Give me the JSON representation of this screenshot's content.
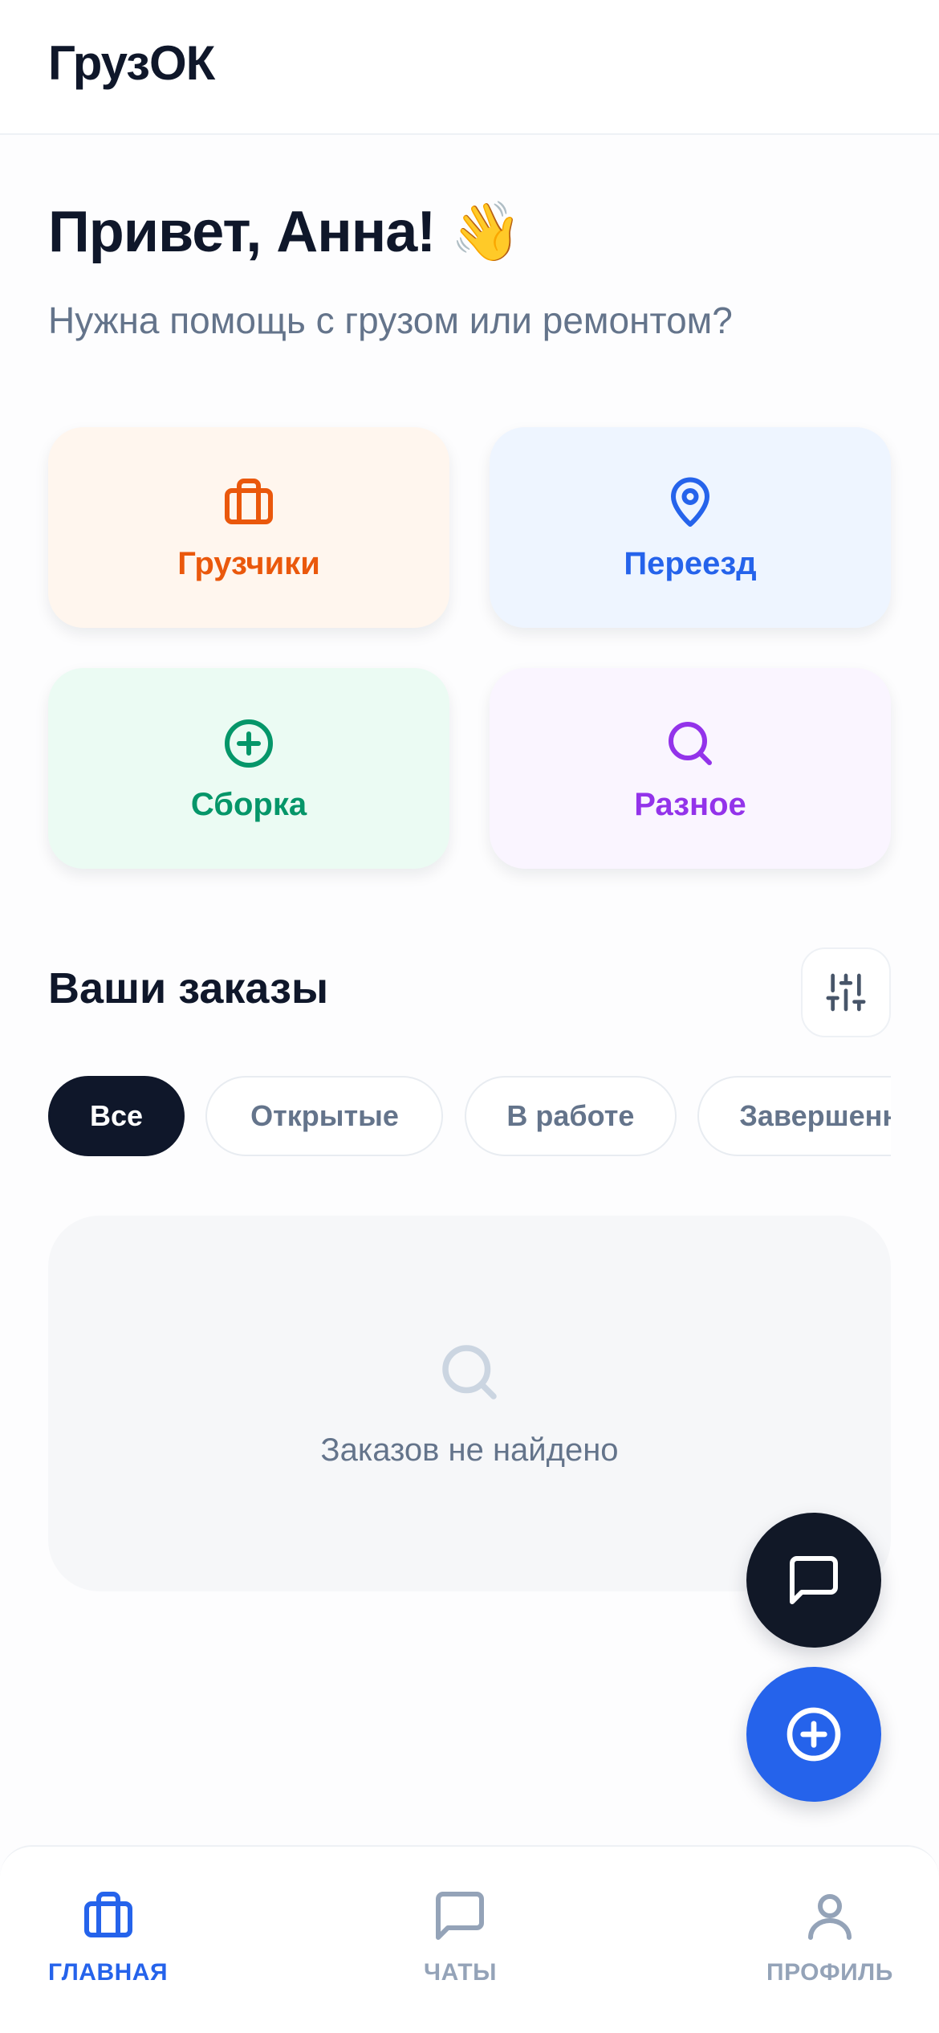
{
  "header": {
    "app_title": "ГрузОК"
  },
  "greeting": {
    "title": "Привет, Анна! 👋",
    "subtitle": "Нужна помощь с грузом или ремонтом?"
  },
  "categories": [
    {
      "label": "Грузчики",
      "icon": "briefcase-icon",
      "color": "#ea580c"
    },
    {
      "label": "Переезд",
      "icon": "map-pin-icon",
      "color": "#2563eb"
    },
    {
      "label": "Сборка",
      "icon": "plus-circle-icon",
      "color": "#059669"
    },
    {
      "label": "Разное",
      "icon": "search-icon",
      "color": "#9333ea"
    }
  ],
  "orders": {
    "title": "Ваши заказы",
    "filter_icon": "sliders-icon",
    "chips": [
      {
        "label": "Все",
        "active": true
      },
      {
        "label": "Открытые",
        "active": false
      },
      {
        "label": "В работе",
        "active": false
      },
      {
        "label": "Завершенные",
        "active": false
      }
    ],
    "empty_text": "Заказов не найдено"
  },
  "fabs": {
    "chat_icon": "chat-icon",
    "add_icon": "plus-circle-icon"
  },
  "tabbar": {
    "items": [
      {
        "label": "ГЛАВНАЯ",
        "icon": "briefcase-icon",
        "active": true
      },
      {
        "label": "ЧАТЫ",
        "icon": "chat-icon",
        "active": false
      },
      {
        "label": "ПРОФИЛЬ",
        "icon": "user-icon",
        "active": false
      }
    ]
  },
  "colors": {
    "accent": "#2563eb",
    "dark": "#0f172a",
    "muted": "#64748b"
  }
}
